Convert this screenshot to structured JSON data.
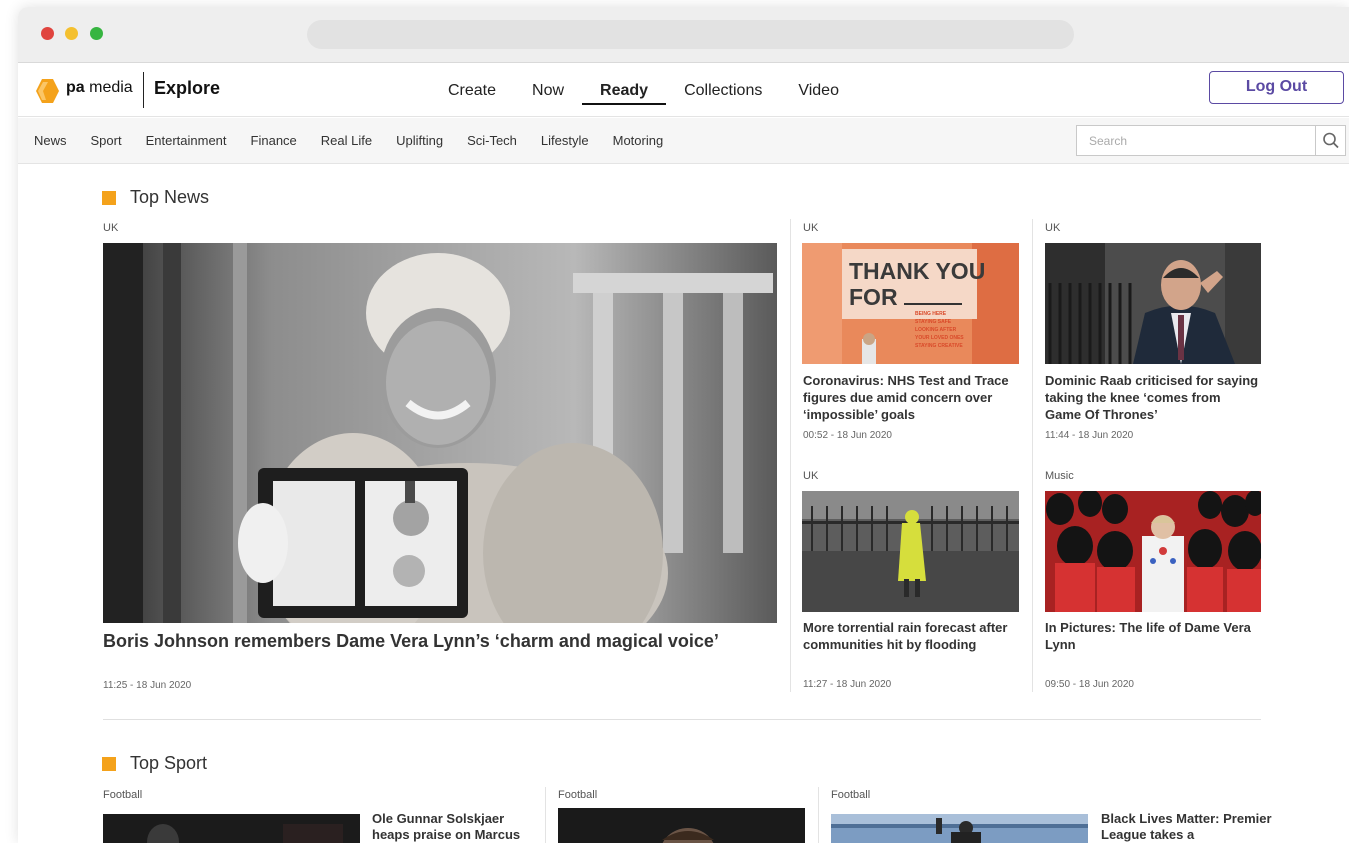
{
  "window": {
    "controls": [
      "close",
      "minimize",
      "maximize"
    ]
  },
  "brand": {
    "logo_icon": "pa-hexagon-logo",
    "logo_bold": "pa",
    "logo_light": "media",
    "product": "Explore"
  },
  "main_nav": [
    {
      "label": "Create"
    },
    {
      "label": "Now"
    },
    {
      "label": "Ready",
      "active": true
    },
    {
      "label": "Collections"
    },
    {
      "label": "Video"
    }
  ],
  "logout_label": "Log Out",
  "sub_nav": [
    "News",
    "Sport",
    "Entertainment",
    "Finance",
    "Real Life",
    "Uplifting",
    "Sci-Tech",
    "Lifestyle",
    "Motoring"
  ],
  "search": {
    "placeholder": "Search",
    "icon": "search-icon"
  },
  "colors": {
    "accent": "#f4a21b",
    "brand_purple": "#5b4aa3"
  },
  "top_news": {
    "title": "Top News",
    "lead": {
      "tag": "UK",
      "headline": "Boris Johnson remembers Dame Vera Lynn’s ‘charm and magical voice’",
      "time": "11:25 - 18 Jun 2020"
    },
    "cards": [
      {
        "tag": "UK",
        "headline": "Coronavirus: NHS Test and Trace figures due amid concern over ‘impossible’ goals",
        "time": "00:52 - 18 Jun 2020",
        "image_text": {
          "line1": "THANK YOU",
          "line2": "FOR",
          "small": [
            "BEING HERE",
            "STAYING SAFE",
            "LOOKING AFTER",
            "YOUR LOVED ONES",
            "STAYING CREATIVE"
          ]
        }
      },
      {
        "tag": "UK",
        "headline": "Dominic Raab criticised for saying taking the knee ‘comes from Game Of Thrones’",
        "time": "11:44 - 18 Jun 2020"
      },
      {
        "tag": "UK",
        "headline": "More torrential rain forecast after communities hit by flooding",
        "time": "11:27 - 18 Jun 2020"
      },
      {
        "tag": "Music",
        "headline": "In Pictures: The life of Dame Vera Lynn",
        "time": "09:50 - 18 Jun 2020"
      }
    ]
  },
  "top_sport": {
    "title": "Top Sport",
    "cards": [
      {
        "tag": "Football",
        "headline": "Ole Gunnar Solskjaer heaps praise on Marcus"
      },
      {
        "tag": "Football"
      },
      {
        "tag": "Football",
        "headline": "Black Lives Matter: Premier League takes a"
      }
    ]
  }
}
